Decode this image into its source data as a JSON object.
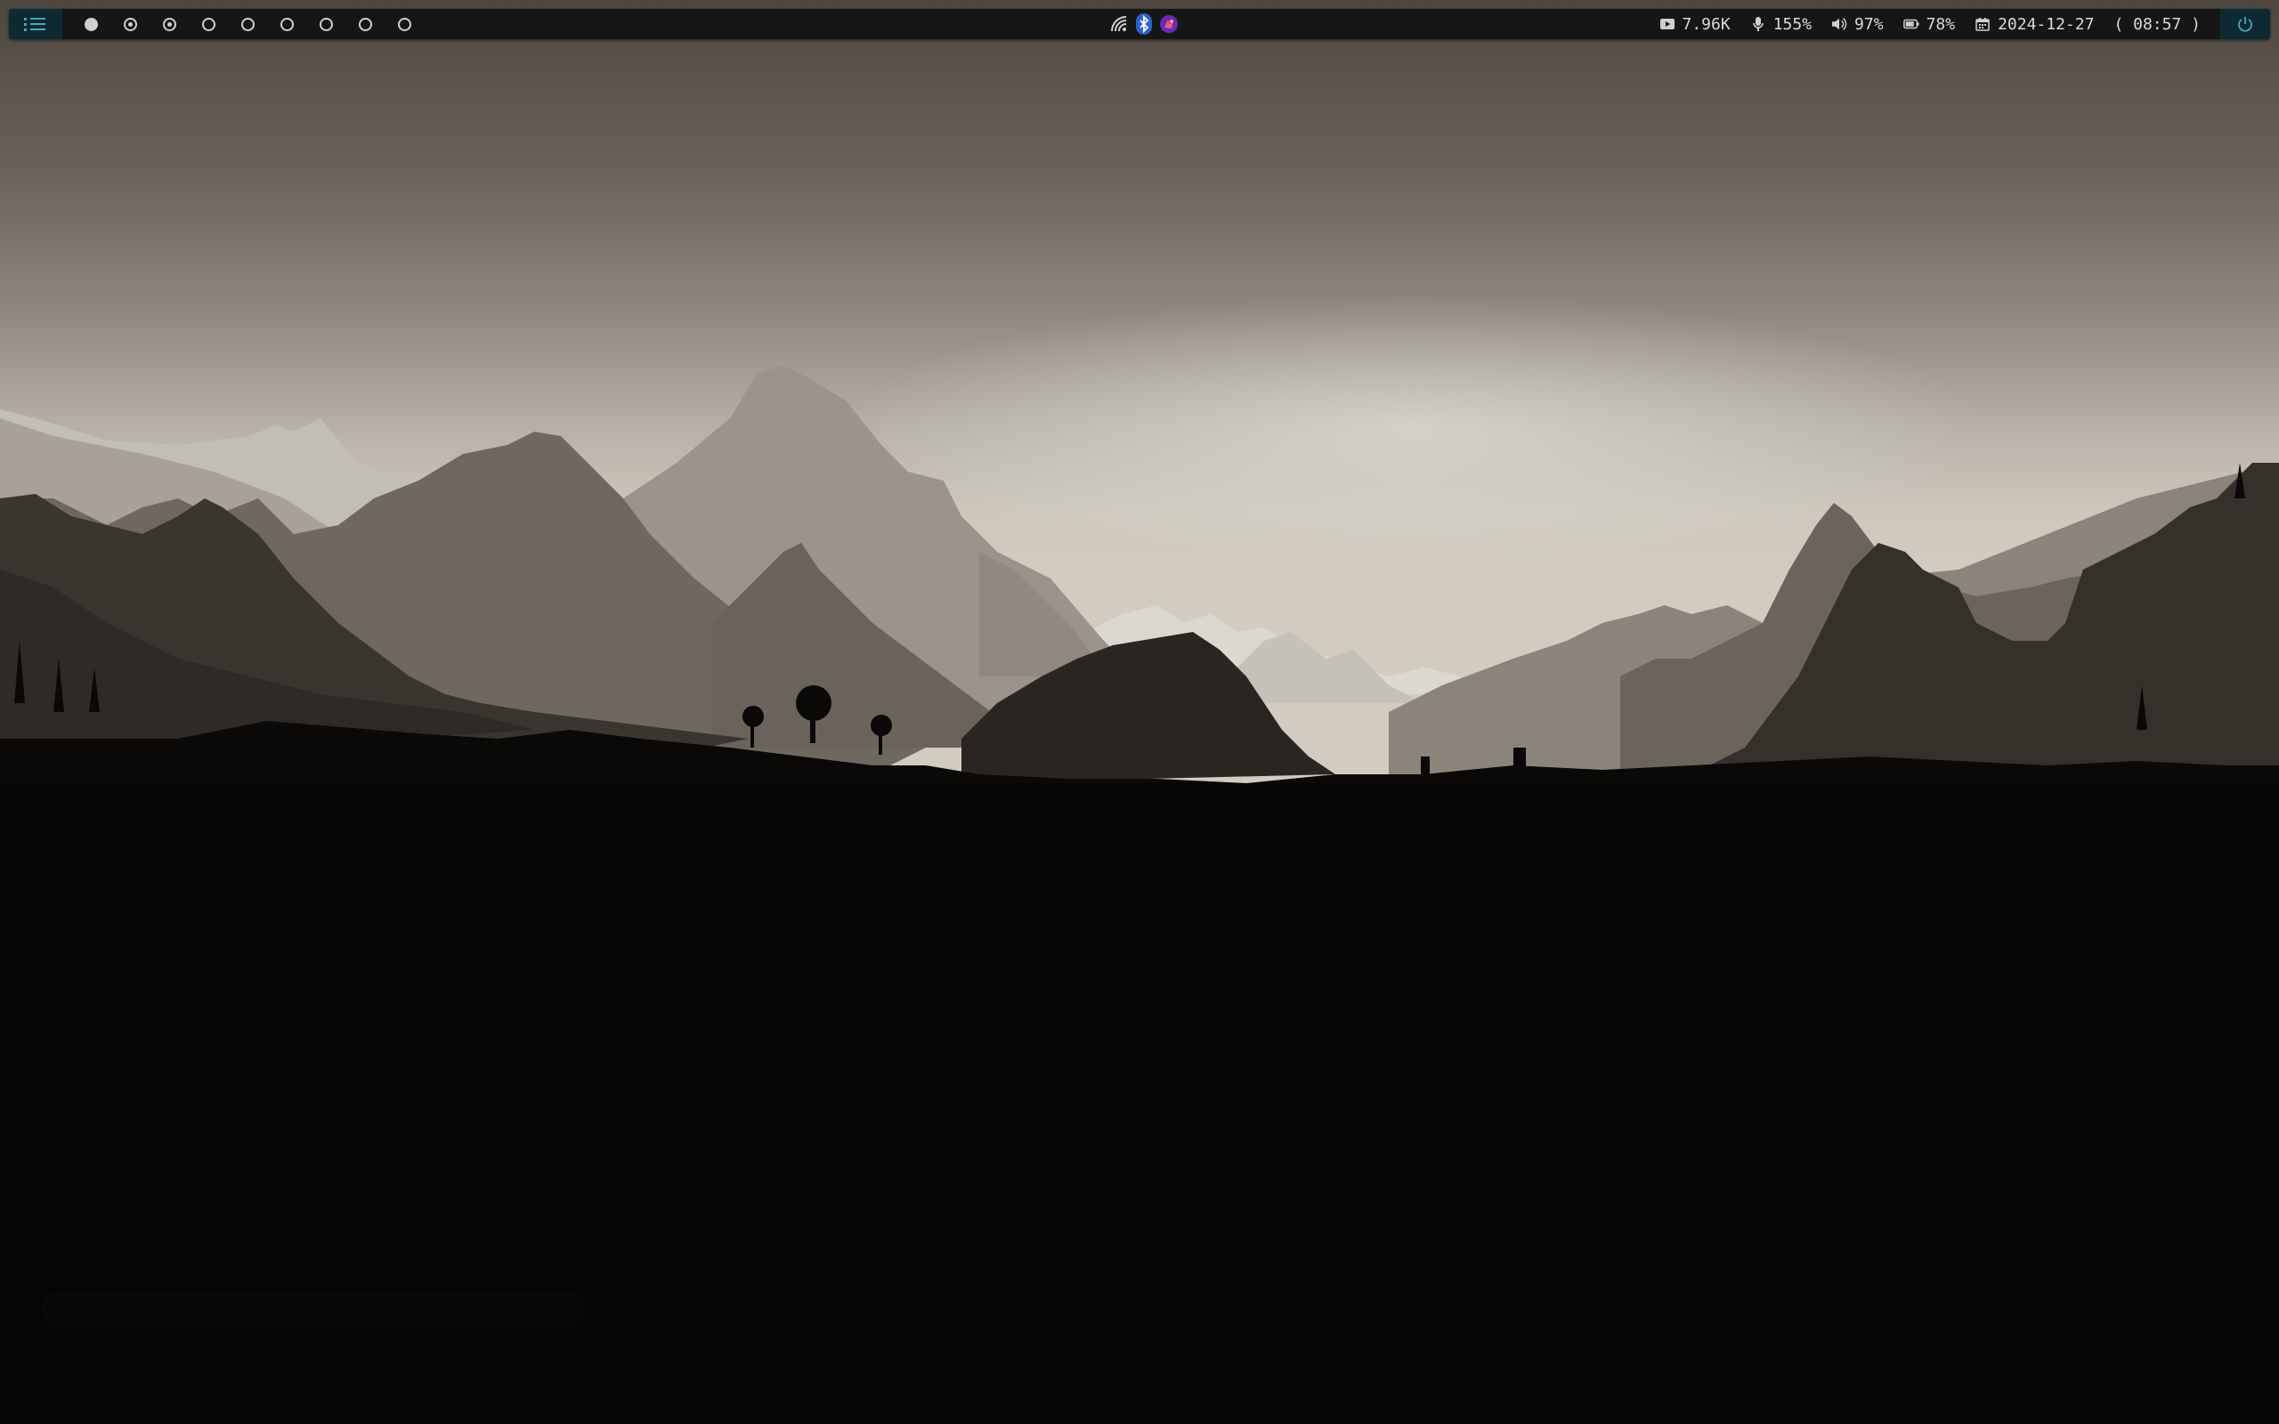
{
  "colors": {
    "bar_background": "#161616",
    "accent_background": "#0d2a33",
    "accent_icon": "#4ea3b6",
    "text": "#d9d9d9",
    "sky_top": "#4e4740",
    "sky_horizon": "#d8d2c6",
    "ground": "#050505"
  },
  "launcher": {
    "icon": "menu-list-icon"
  },
  "workspaces": [
    {
      "icon": "circle-filled",
      "state": "active"
    },
    {
      "icon": "circle-dot",
      "state": "occupied"
    },
    {
      "icon": "circle-dot",
      "state": "occupied"
    },
    {
      "icon": "circle-outline",
      "state": "empty"
    },
    {
      "icon": "circle-outline",
      "state": "empty"
    },
    {
      "icon": "circle-outline",
      "state": "empty"
    },
    {
      "icon": "circle-outline",
      "state": "empty"
    },
    {
      "icon": "circle-outline",
      "state": "empty"
    },
    {
      "icon": "circle-outline",
      "state": "empty"
    }
  ],
  "tray": [
    {
      "icon": "wifi-icon"
    },
    {
      "icon": "bluetooth-icon"
    },
    {
      "icon": "app-indicator-icon"
    }
  ],
  "status": {
    "network_speed": "7.96K",
    "mic_level": "155%",
    "volume": "97%",
    "battery": "78%",
    "date": "2024-12-27",
    "time": "( 08:57 )"
  },
  "power": {
    "icon": "power-icon"
  }
}
